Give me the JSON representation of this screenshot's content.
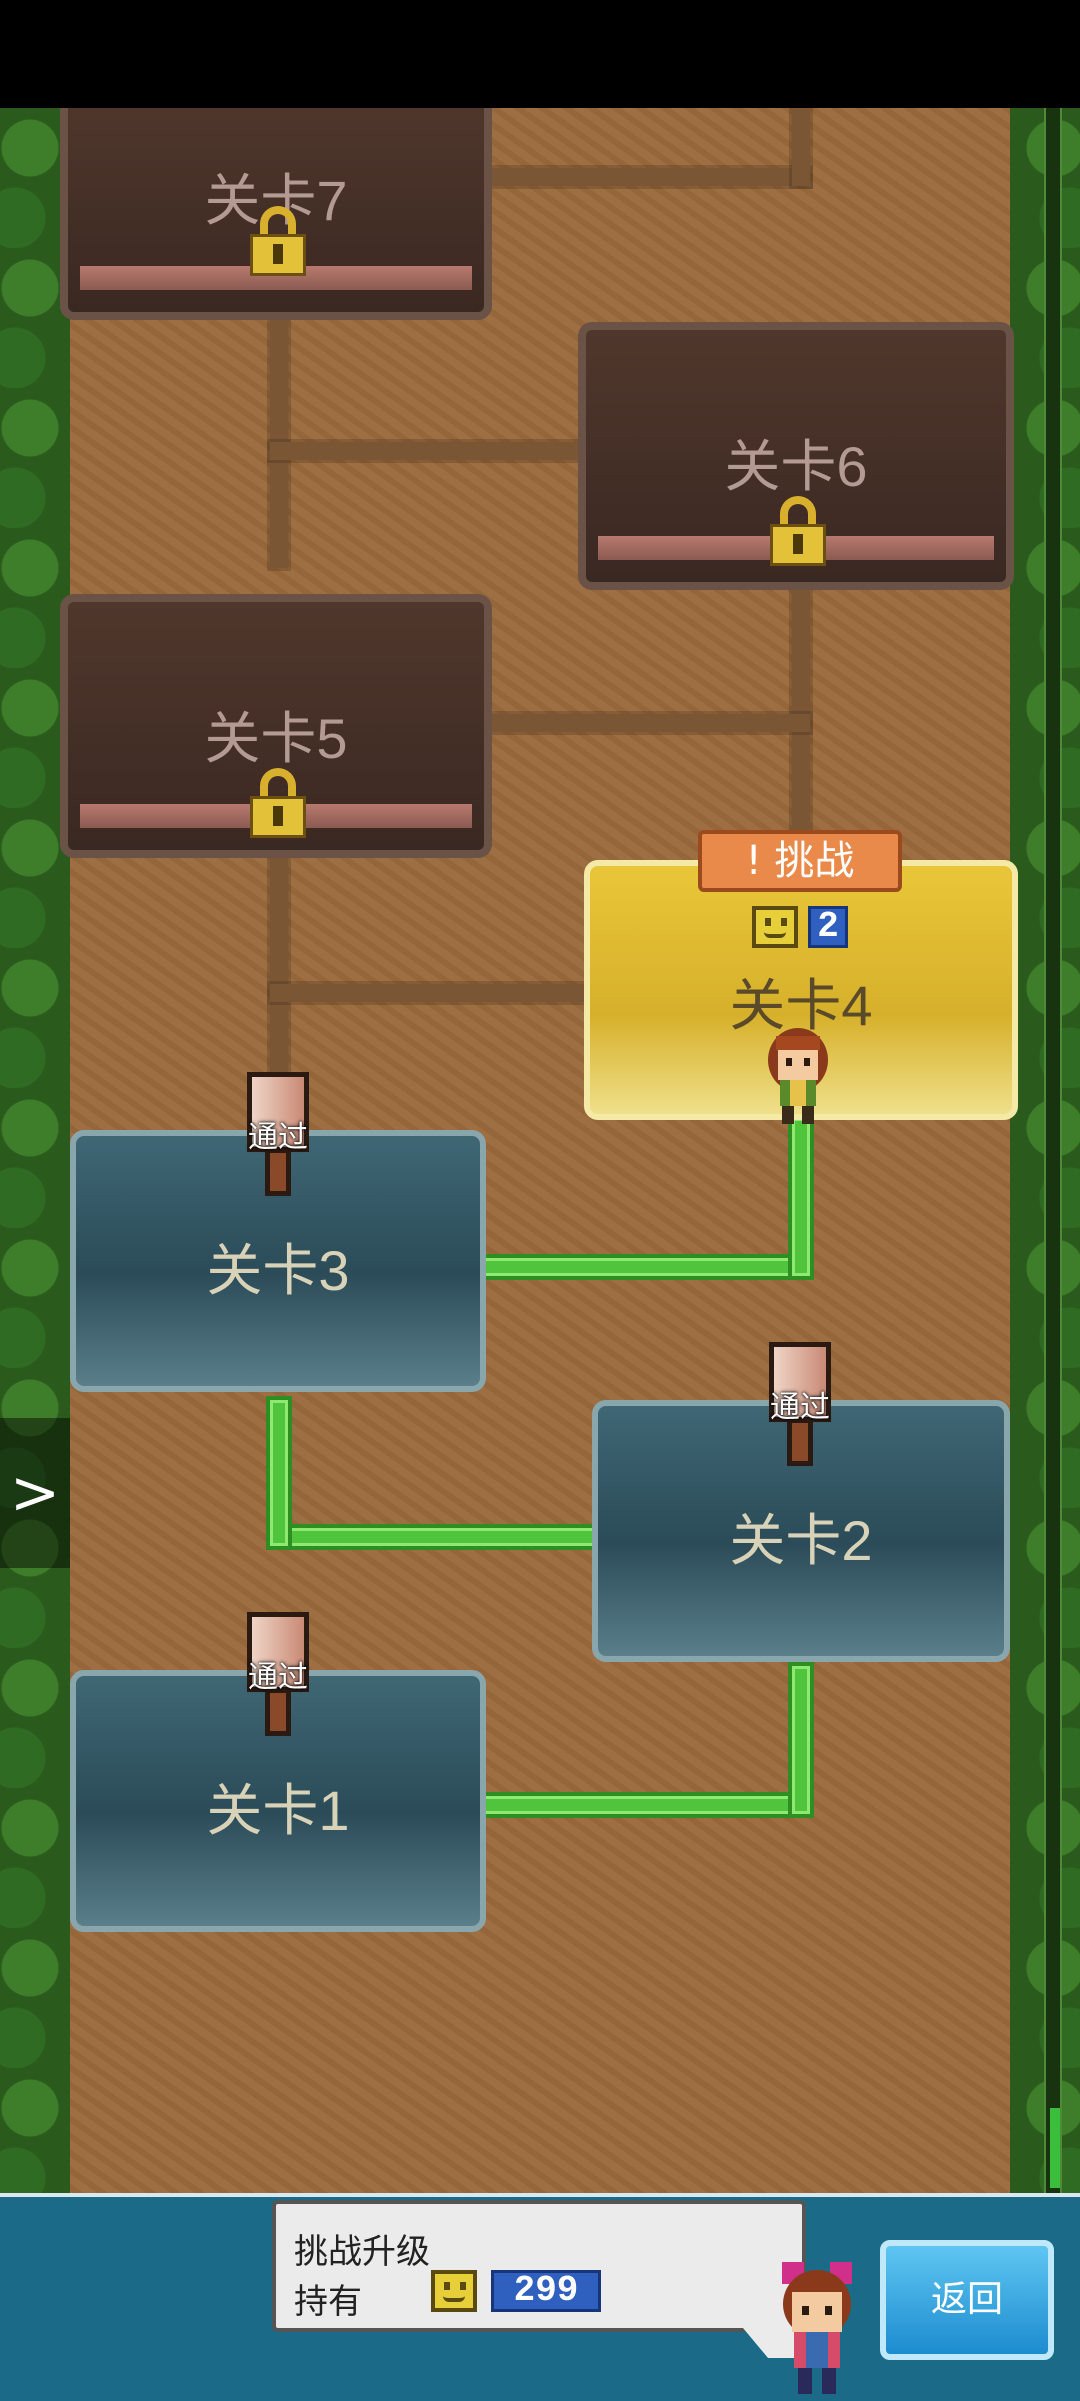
{
  "stages": [
    {
      "label": "关卡1",
      "state": "cleared",
      "badge": "通过"
    },
    {
      "label": "关卡2",
      "state": "cleared",
      "badge": "通过"
    },
    {
      "label": "关卡3",
      "state": "cleared",
      "badge": "通过"
    },
    {
      "label": "关卡4",
      "state": "current",
      "tag": "! 挑战",
      "required": "2"
    },
    {
      "label": "关卡5",
      "state": "locked"
    },
    {
      "label": "关卡6",
      "state": "locked"
    },
    {
      "label": "关卡7",
      "state": "locked"
    }
  ],
  "side_arrow": ">",
  "bottom": {
    "line1": "挑战升级",
    "line2": "持有",
    "held_value": "299",
    "back_label": "返回"
  },
  "colors": {
    "cleared_path": "#4fc43c",
    "locked_path": "#7b5635",
    "current_stage": "#e9c639",
    "cleared_stage": "#3f6774",
    "locked_stage": "#50372c",
    "back_button": "#1d8ccf"
  },
  "icons": [
    "lock-icon",
    "smiley-token-icon",
    "pass-flag-icon",
    "arrow-right-icon"
  ]
}
